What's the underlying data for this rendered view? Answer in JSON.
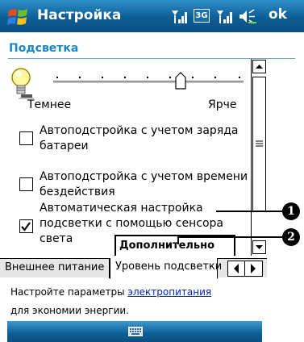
{
  "titlebar": {
    "title": "Настройка",
    "network_badge": "3G",
    "ok_label": "ok",
    "icons": [
      "windows-start-icon",
      "signal-strength-icon",
      "signal-strength-icon",
      "speaker-icon"
    ]
  },
  "section": {
    "title": "Подсветка"
  },
  "brightness": {
    "label_dark": "Темнее",
    "label_bright": "Ярче",
    "level_fraction": 0.7
  },
  "options": [
    {
      "label": "Автоподстройка с учетом заряда батареи",
      "checked": false
    },
    {
      "label": "Автоподстройка с учетом времени бездействия",
      "checked": false
    },
    {
      "label": "Автоматическая настройка подсветки с помощью сенсора света",
      "checked": true
    }
  ],
  "more_button": {
    "label": "Дополнительно"
  },
  "callouts": [
    "1",
    "2"
  ],
  "tabs": [
    {
      "label": "Внешнее питание",
      "active": false
    },
    {
      "label": "Уровень подсветки",
      "active": true
    }
  ],
  "footer": {
    "text_before_link": "Настройте параметры ",
    "link_text": "электропитания",
    "text_line2": "для экономии энергии."
  },
  "colors": {
    "titlebar": "#0d5d96",
    "section_title": "#1a86c8",
    "link": "#0022cc"
  }
}
